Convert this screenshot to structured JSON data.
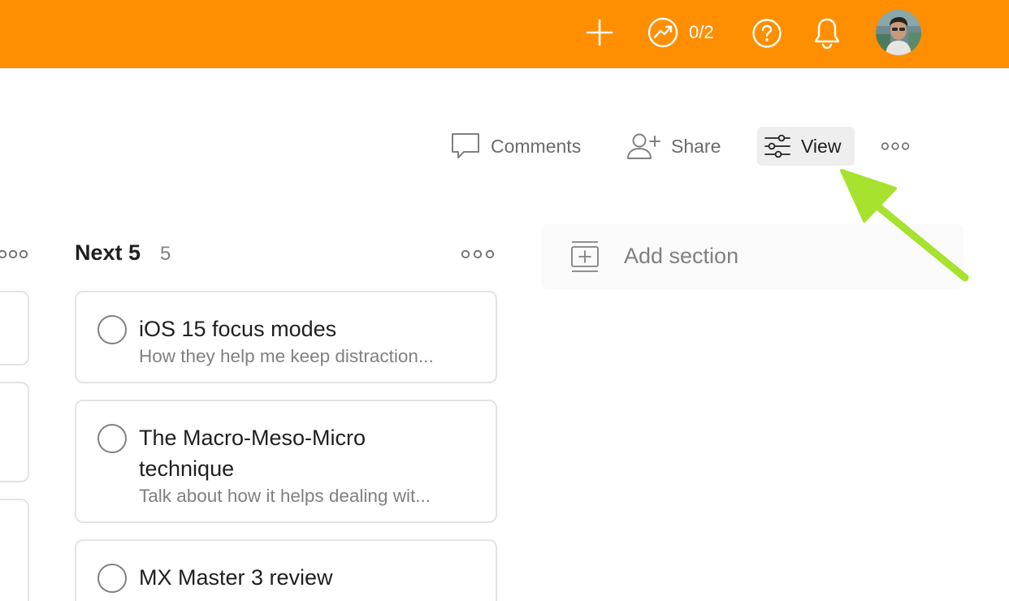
{
  "topbar": {
    "karma_text": "0/2",
    "colors": {
      "background": "#ff8f00",
      "icons": "#ffffff"
    }
  },
  "header": {
    "comments_label": "Comments",
    "share_label": "Share",
    "view_label": "View"
  },
  "column": {
    "title": "Next 5",
    "count": "5",
    "cards": [
      {
        "title": "iOS 15 focus modes",
        "description": "How they help me keep distraction..."
      },
      {
        "title": "The Macro-Meso-Micro technique",
        "description": "Talk about how it helps dealing wit..."
      },
      {
        "title": "MX Master 3 review",
        "description": ""
      }
    ]
  },
  "add_section": {
    "label": "Add section"
  },
  "annotation": {
    "arrow_color": "#a6e22e"
  }
}
